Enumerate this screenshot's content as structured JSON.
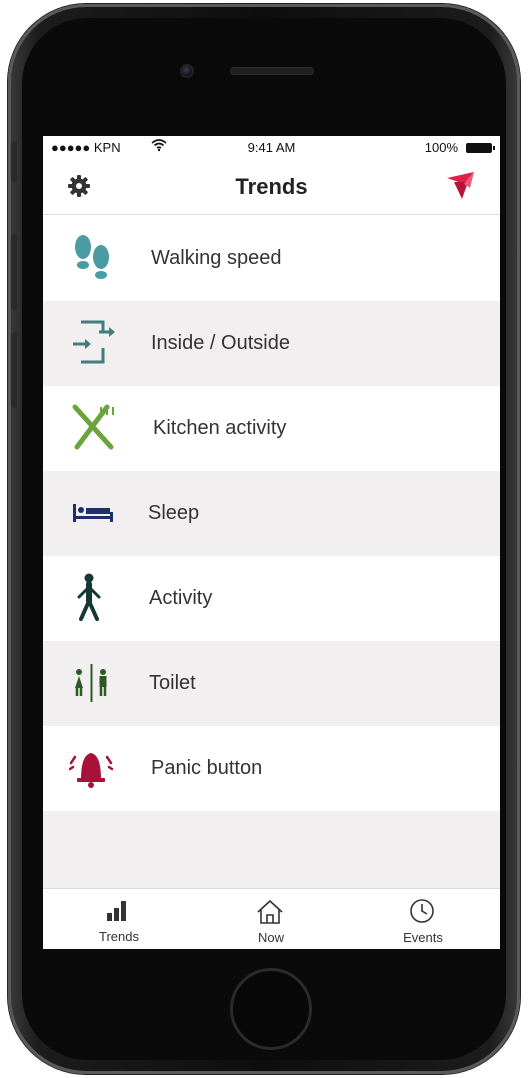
{
  "status_bar": {
    "carrier": "●●●●● KPN",
    "wifi_icon": "wifi-icon",
    "time": "9:41 AM",
    "battery": "100%"
  },
  "nav": {
    "title": "Trends",
    "settings_icon": "gear-icon",
    "logo_icon": "bird-logo-icon"
  },
  "items": [
    {
      "label": "Walking speed",
      "icon": "footprints-icon",
      "color": "#4b9ba3"
    },
    {
      "label": "Inside / Outside",
      "icon": "door-exit-icon",
      "color": "#3e7e7e"
    },
    {
      "label": "Kitchen activity",
      "icon": "fork-knife-icon",
      "color": "#6aa43a"
    },
    {
      "label": "Sleep",
      "icon": "bed-icon",
      "color": "#1e2f6e"
    },
    {
      "label": "Activity",
      "icon": "walking-person-icon",
      "color": "#163832"
    },
    {
      "label": "Toilet",
      "icon": "restroom-icon",
      "color": "#2d5a22"
    },
    {
      "label": "Panic button",
      "icon": "alarm-bell-icon",
      "color": "#a8123a"
    }
  ],
  "tabs": [
    {
      "label": "Trends",
      "icon": "bar-chart-icon"
    },
    {
      "label": "Now",
      "icon": "home-icon"
    },
    {
      "label": "Events",
      "icon": "clock-icon"
    }
  ],
  "colors": {
    "alt_row": "#f2eff0",
    "logo_red": "#e01f4a"
  }
}
